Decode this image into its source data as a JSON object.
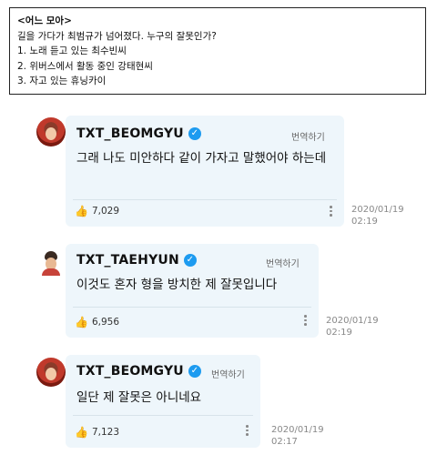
{
  "question": {
    "title": "<어느 모아>",
    "prompt": "길을 가다가 최범규가 넘어졌다. 누구의 잘못인가?",
    "options": [
      "1. 노래 듣고 있는 최수빈씨",
      "2. 위버스에서 활동 중인 강태현씨",
      "3. 자고 있는 휴닝카이"
    ]
  },
  "comments": [
    {
      "username": "TXT_BEOMGYU",
      "translate": "번역하기",
      "text": "그래 나도 미안하다 같이 가자고 말했어야 하는데",
      "likes": "7,029",
      "date": "2020/01/19",
      "time": "02:19"
    },
    {
      "username": "TXT_TAEHYUN",
      "translate": "번역하기",
      "text": "이것도 혼자 형을 방치한 제 잘못입니다",
      "likes": "6,956",
      "date": "2020/01/19",
      "time": "02:19"
    },
    {
      "username": "TXT_BEOMGYU",
      "translate": "번역하기",
      "text": "일단 제 잘못은 아니네요",
      "likes": "7,123",
      "date": "2020/01/19",
      "time": "02:17"
    }
  ],
  "icons": {
    "verified": "verified-badge-icon",
    "like": "thumbs-up-icon",
    "more": "more-vertical-icon"
  },
  "colors": {
    "card_bg": "#eef6fb",
    "verified": "#1d9bf0"
  }
}
